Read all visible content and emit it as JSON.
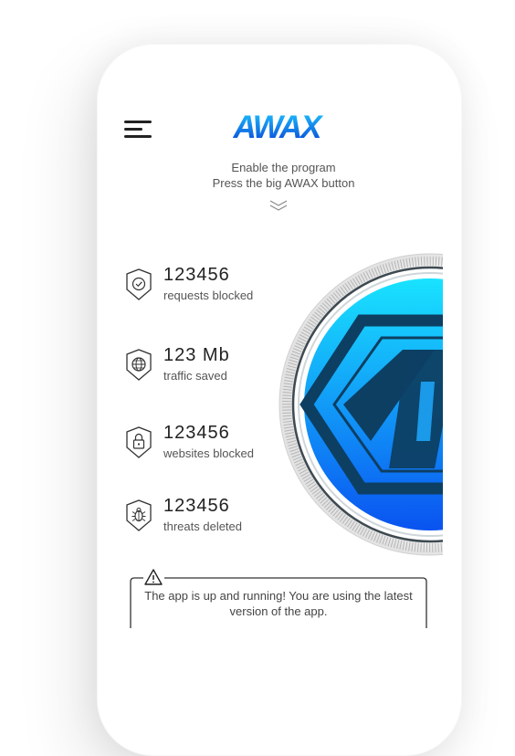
{
  "app": {
    "logo": "AWAX"
  },
  "instructions": {
    "line1": "Enable the program",
    "line2": "Press the big AWAX button"
  },
  "stats": [
    {
      "value": "123456",
      "label": "requests blocked",
      "icon": "shield-check-icon"
    },
    {
      "value": "123 Mb",
      "label": "traffic saved",
      "icon": "shield-globe-icon"
    },
    {
      "value": "123456",
      "label": "websites blocked",
      "icon": "shield-lock-icon"
    },
    {
      "value": "123456",
      "label": "threats deleted",
      "icon": "shield-bug-icon"
    }
  ],
  "notice": {
    "icon": "warning-icon",
    "text": "The app is up and running! You are using the latest version of the app."
  },
  "colors": {
    "button_top": "#19E3FF",
    "button_bottom": "#0A53F0",
    "emblem": "#0d3f63"
  }
}
